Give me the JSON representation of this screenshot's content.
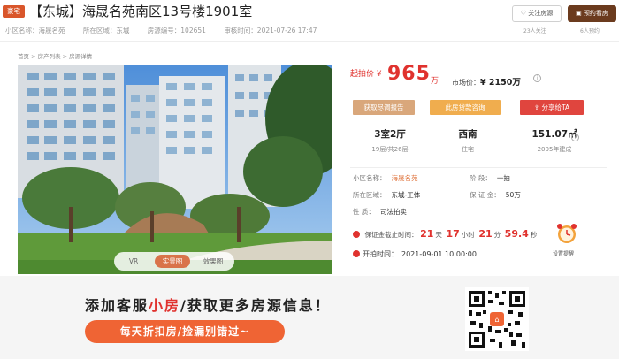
{
  "header": {
    "badge": "豪宅",
    "title": "【东城】海晟名苑南区13号楼1901室",
    "meta": {
      "community": "小区名称：海晟名苑",
      "district": "所在区域：东城",
      "listing_no": "房源编号：102651",
      "review_time": "审核时间：2021-07-26 17:47"
    },
    "follow_label": "关注房源",
    "follow_count": "23人关注",
    "visit_label": "预约看房",
    "visit_count": "6人预约"
  },
  "breadcrumb": "首页 > 房产列表 > 房源详情",
  "photo_tabs": {
    "vr": "VR",
    "real": "实景图",
    "effect": "效果图"
  },
  "price": {
    "start_label": "起拍价",
    "currency": "¥",
    "start_value": "965",
    "unit": "万",
    "market_label": "市场价：",
    "market_value": "¥ 2150万"
  },
  "actions": {
    "report": "获取尽调报告",
    "loan": "此房贷款咨询",
    "share": "分享给TA"
  },
  "stats": [
    {
      "value": "3室2厅",
      "sub": "19层/共26层"
    },
    {
      "value": "西南",
      "sub": "住宅"
    },
    {
      "value": "151.07㎡",
      "sub": "2005年建成"
    }
  ],
  "details": {
    "community_label": "小区名称：",
    "community_value": "海晟名苑",
    "stage_label": "阶    段：",
    "stage_value": "一拍",
    "area_label": "所在区域：",
    "area_value": "东城-工体",
    "deposit_label": "保 证 金：",
    "deposit_value": "50万",
    "nature_label": "性    质：",
    "nature_value": "司法拍卖"
  },
  "countdown": {
    "label": "保证金截止时间：",
    "days": "21",
    "days_unit": "天",
    "hours": "17",
    "hours_unit": "小时",
    "minutes": "21",
    "minutes_unit": "分",
    "seconds": "59.4",
    "seconds_unit": "秒"
  },
  "start_time": {
    "label": "开拍时间：",
    "value": "2021-09-01 10:00:00"
  },
  "reminder_label": "设置提醒",
  "banner": {
    "text1": "添加客服",
    "highlight": "小房",
    "text2": "/获取更多房源信息！",
    "button": "每天折扣房/捡漏别错过~"
  },
  "colors": {
    "accent": "#e0322e",
    "brand": "#ef6434",
    "badge": "#d9562b"
  }
}
